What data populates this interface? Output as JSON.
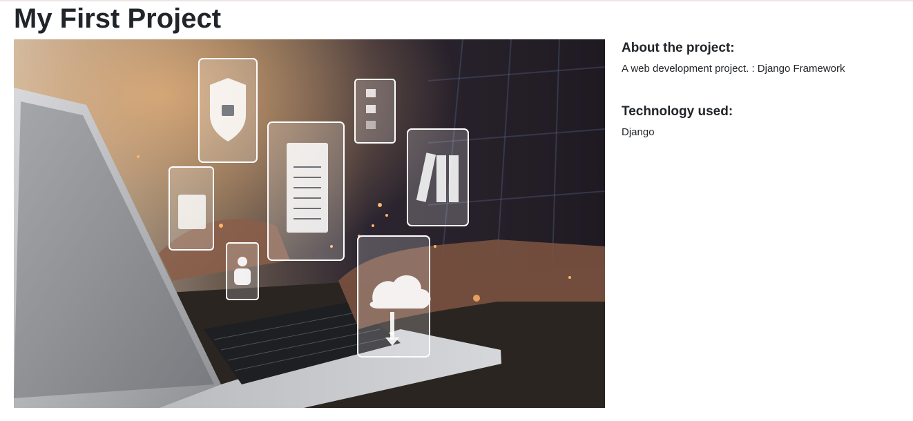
{
  "page": {
    "title": "My First Project"
  },
  "project_image": {
    "icon_names": [
      "shield-lock-icon",
      "checklist-icon",
      "document-icon",
      "folder-icon",
      "books-icon",
      "users-icon",
      "cloud-upload-icon"
    ]
  },
  "about": {
    "heading": "About the project:",
    "text": "A web development project. : Django Framework"
  },
  "technology": {
    "heading": "Technology used:",
    "text": "Django"
  },
  "colors": {
    "text": "#212529",
    "background": "#ffffff"
  }
}
